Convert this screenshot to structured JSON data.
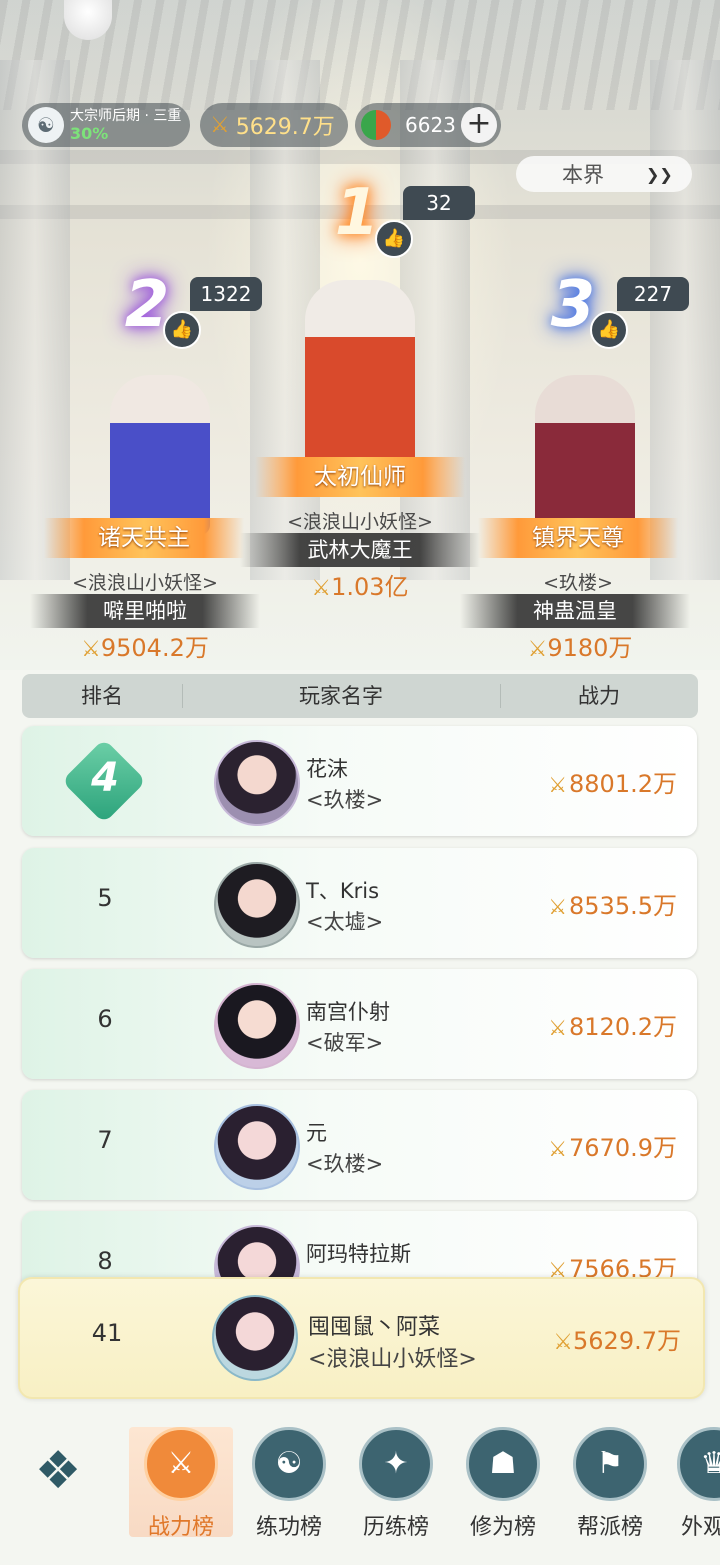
{
  "header": {
    "realm_label": "大宗师后期 · 三重",
    "realm_progress": "30%",
    "power": "5629.7万",
    "jade": "6623",
    "scope_selector": "本界"
  },
  "podium": [
    {
      "rank": "1",
      "likes": "32",
      "title": "太初仙师",
      "guild": "<浪浪山小妖怪>",
      "name": "武林大魔王",
      "power": "1.03亿"
    },
    {
      "rank": "2",
      "likes": "1322",
      "title": "诸天共主",
      "guild": "<浪浪山小妖怪>",
      "name": "噼里啪啦",
      "power": "9504.2万"
    },
    {
      "rank": "3",
      "likes": "227",
      "title": "镇界天尊",
      "guild": "<玖楼>",
      "name": "神蛊温皇",
      "power": "9180万"
    }
  ],
  "table": {
    "headers": [
      "排名",
      "玩家名字",
      "战力"
    ],
    "rows": [
      {
        "rank": "4",
        "name": "花沫",
        "guild": "<玖楼>",
        "power": "8801.2万"
      },
      {
        "rank": "5",
        "name": "T、Kris",
        "guild": "<太墟>",
        "power": "8535.5万"
      },
      {
        "rank": "6",
        "name": "南宫仆射",
        "guild": "<破军>",
        "power": "8120.2万"
      },
      {
        "rank": "7",
        "name": "元",
        "guild": "<玖楼>",
        "power": "7670.9万"
      },
      {
        "rank": "8",
        "name": "阿玛特拉斯",
        "guild": "",
        "power": "7566.5万"
      }
    ]
  },
  "self_row": {
    "rank": "41",
    "name": "囤囤鼠丶阿菜",
    "guild": "<浪浪山小妖怪>",
    "power": "5629.7万"
  },
  "nav": {
    "items": [
      "战力榜",
      "练功榜",
      "历练榜",
      "修为榜",
      "帮派榜",
      "外观"
    ],
    "active": "战力榜"
  },
  "colors": {
    "accent": "#e0782a",
    "power_text": "#d9782a",
    "nav_icon": "#3d6470"
  }
}
